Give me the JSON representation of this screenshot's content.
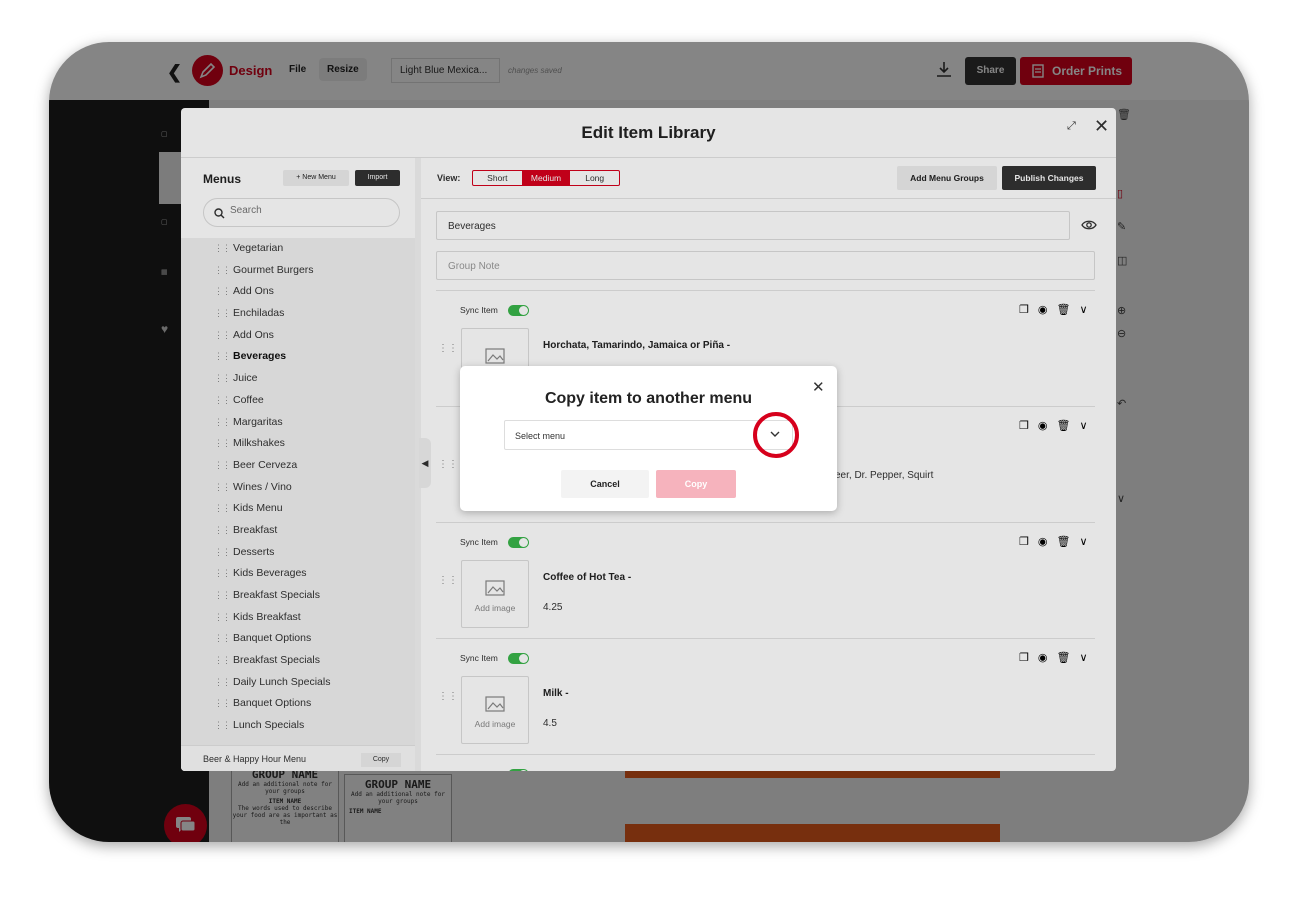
{
  "topbar": {
    "brand": "Design",
    "file": "File",
    "resize": "Resize",
    "doc_name": "Light Blue Mexica...",
    "saved_status": "changes saved",
    "share": "Share",
    "order_prints": "Order Prints"
  },
  "modal": {
    "title": "Edit Item Library",
    "menus_heading": "Menus",
    "new_menu": "+ New Menu",
    "import": "Import",
    "search_placeholder": "Search",
    "menu_items": [
      "Vegetarian",
      "Gourmet Burgers",
      "Add Ons",
      "Enchiladas",
      "Add Ons",
      "Beverages",
      "Juice",
      "Coffee",
      "Margaritas",
      "Milkshakes",
      "Beer Cerveza",
      "Wines / Vino",
      "Kids Menu",
      "Breakfast",
      "Desserts",
      "Kids Beverages",
      "Breakfast Specials",
      "Kids Breakfast",
      "Banquet Options",
      "Breakfast Specials",
      "Daily Lunch Specials",
      "Banquet Options",
      "Lunch Specials"
    ],
    "selected_menu": "Beverages",
    "footer_menu": "Beer & Happy Hour Menu",
    "footer_copy": "Copy",
    "view_label": "View:",
    "view_options": [
      "Short",
      "Medium",
      "Long"
    ],
    "view_selected": "Medium",
    "add_menu_groups": "Add Menu Groups",
    "publish_changes": "Publish Changes",
    "group_name": "Beverages",
    "group_note_placeholder": "Group Note",
    "sync_label": "Sync Item",
    "add_image": "Add image",
    "items": [
      {
        "name": "Horchata, Tamarindo, Jamaica or Piña -",
        "price": ""
      },
      {
        "name": "",
        "desc": "eer, Dr. Pepper, Squirt"
      },
      {
        "name": "Coffee of Hot Tea -",
        "price": "4.25"
      },
      {
        "name": "Milk -",
        "price": "4.5"
      }
    ]
  },
  "copy_dialog": {
    "title": "Copy item to another menu",
    "select_placeholder": "Select menu",
    "cancel": "Cancel",
    "copy": "Copy"
  },
  "thumbs": {
    "group_name": "GROUP NAME",
    "note": "Add an additional note for your groups",
    "item_name": "ITEM NAME",
    "item_desc": "The words used to describe your food are as important as the"
  },
  "colors": {
    "accent": "#d6001c",
    "toggle": "#39b54a",
    "dark": "#333333"
  }
}
